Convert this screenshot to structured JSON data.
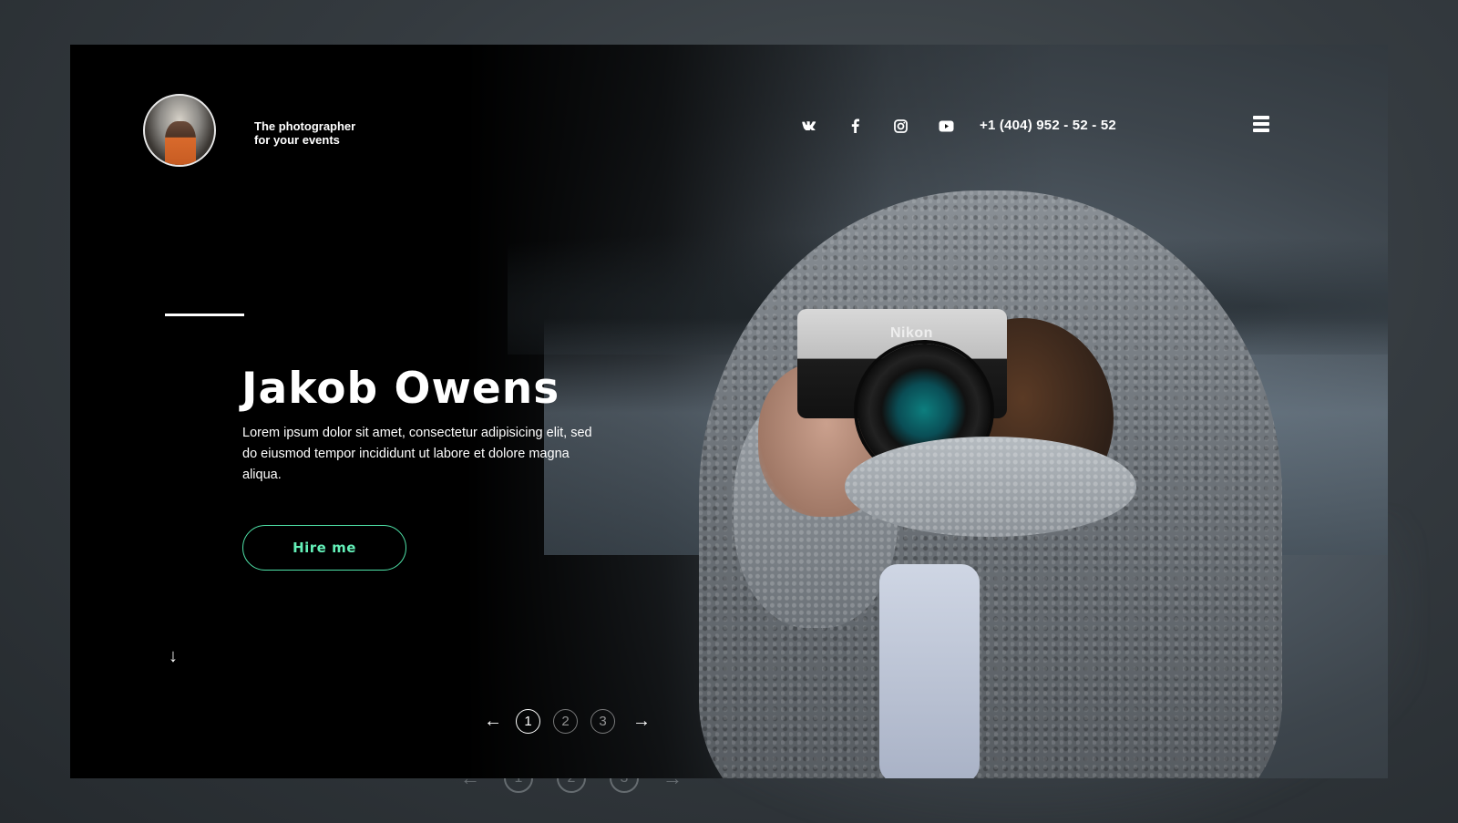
{
  "site": {
    "tagline_line1": "The photographer",
    "tagline_line2": "for your events",
    "phone": "+1 (404) 952 - 52 - 52",
    "social": [
      {
        "name": "vk-icon",
        "glyph": "vk"
      },
      {
        "name": "facebook-icon",
        "glyph": "f"
      },
      {
        "name": "instagram-icon",
        "glyph": "ig"
      },
      {
        "name": "youtube-icon",
        "glyph": "yt"
      }
    ]
  },
  "hero": {
    "title": "Jakob Owens",
    "lead": "Lorem ipsum dolor sit amet, consectetur adipisicing elit, sed do eiusmod tempor incididunt ut labore et dolore magna aliqua.",
    "cta_label": "Hire me",
    "camera_brand": "Nikon",
    "accent_color": "#4fe3a9"
  },
  "pager": {
    "prev": "←",
    "next": "→",
    "pages": [
      "1",
      "2",
      "3"
    ],
    "active": "1",
    "scroll_down": "↓"
  }
}
